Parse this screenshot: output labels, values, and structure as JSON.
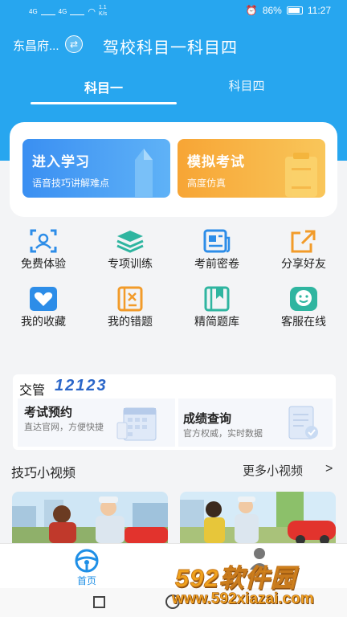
{
  "status_bar": {
    "left_signal_1": "4G",
    "left_signal_2": "4G",
    "net_speed": "1.1 K/s",
    "battery": "86%",
    "battery_level": 0.86,
    "time": "11:27"
  },
  "header": {
    "city": "东昌府...",
    "title": "驾校科目一科目四"
  },
  "tabs": [
    {
      "label": "科目一",
      "active": true
    },
    {
      "label": "科目四",
      "active": false
    }
  ],
  "main_buttons": {
    "study": {
      "title": "进入学习",
      "subtitle": "语音技巧讲解难点"
    },
    "exam": {
      "title": "模拟考试",
      "subtitle": "高度仿真"
    }
  },
  "grid": [
    {
      "label": "免费体验",
      "icon": "face-scan-icon"
    },
    {
      "label": "专项训练",
      "icon": "layers-icon"
    },
    {
      "label": "考前密卷",
      "icon": "newspaper-icon"
    },
    {
      "label": "分享好友",
      "icon": "share-icon"
    },
    {
      "label": "我的收藏",
      "icon": "heart-icon"
    },
    {
      "label": "我的错题",
      "icon": "wrong-book-icon"
    },
    {
      "label": "精简题库",
      "icon": "bookmark-book-icon"
    },
    {
      "label": "客服在线",
      "icon": "smile-chat-icon"
    }
  ],
  "jiaoguan": {
    "title": "交管",
    "number": "12123",
    "booking": {
      "title": "考试预约",
      "subtitle": "直达官网，方便快捷"
    },
    "score": {
      "title": "成绩查询",
      "subtitle": "官方权威，实时数据"
    }
  },
  "videos": {
    "title": "技巧小视频",
    "more": "更多小视频",
    "arrow": ">"
  },
  "tabbar": {
    "home": "首页"
  },
  "watermark": {
    "logo": "592软件园",
    "url": "www.592xiazai.com"
  },
  "colors": {
    "primary": "#27a6ef",
    "study_btn": "#3a8ff2",
    "exam_btn": "#f7a535",
    "watermark": "#f0a21d"
  }
}
